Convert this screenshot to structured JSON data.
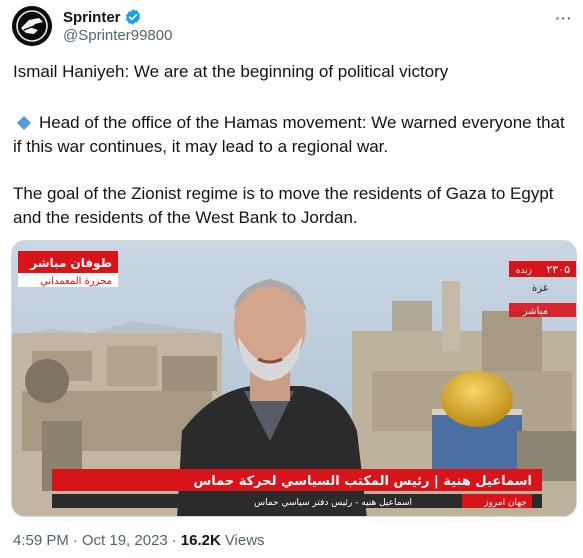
{
  "author": {
    "display_name": "Sprinter",
    "handle": "@Sprinter99800",
    "verified_icon": "verified-badge-icon",
    "avatar_icon": "sprinter-logo-icon"
  },
  "menu": {
    "more_icon": "more-horizontal-icon",
    "more_glyph": "···"
  },
  "tweet": {
    "para1": "Ismail Haniyeh: We are at the beginning of political victory",
    "para2": "Head of the office of the Hamas movement: We warned everyone that if this war continues, it may lead to a regional war.",
    "para2_icon": "blue-diamond-icon",
    "para3": "The goal of the Zionist regime is to move the residents of Gaza to Egypt and the residents of the West Bank to Jordan."
  },
  "media": {
    "lower_third_main": "اسماعيل هنية | رئيس المكتب السياسي لحركة حماس",
    "lower_third_sub": "اسماعيل هنيه - رئيس دفتر سياسي حماس",
    "channel_tag": "جهان امروز",
    "top_left_badge": "طوفان مباشر",
    "top_left_sub": "مجزرة المعمداني",
    "top_right_number": "۲۳۰۵",
    "top_right_label": "زنده",
    "right_city": "غزة",
    "right_live": "مباشر",
    "colors": {
      "red": "#d7141a",
      "dark": "#2b2b2b"
    }
  },
  "meta": {
    "time": "4:59 PM",
    "separator": "·",
    "date": "Oct 19, 2023",
    "views_count": "16.2K",
    "views_label": "Views"
  },
  "colors": {
    "text": "#0f1419",
    "secondary": "#536471",
    "verified": "#1d9bf0"
  }
}
